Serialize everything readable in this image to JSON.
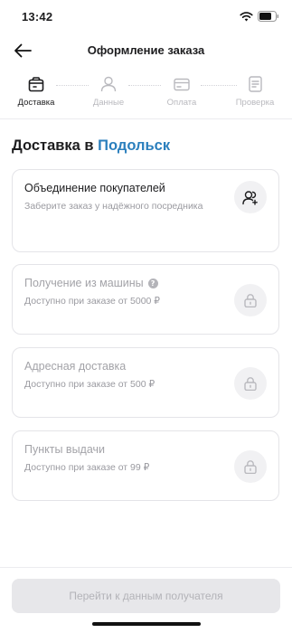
{
  "status_bar": {
    "time": "13:42"
  },
  "header": {
    "title": "Оформление заказа"
  },
  "steps": [
    {
      "label": "Доставка",
      "state": "active",
      "icon": "box-icon"
    },
    {
      "label": "Данные",
      "state": "inactive",
      "icon": "user-icon"
    },
    {
      "label": "Оплата",
      "state": "inactive",
      "icon": "card-icon"
    },
    {
      "label": "Проверка",
      "state": "inactive",
      "icon": "document-icon"
    }
  ],
  "section": {
    "title_prefix": "Доставка в",
    "city": "Подольск"
  },
  "options": [
    {
      "title": "Объединение покупателей",
      "subtitle": "Заберите заказ у надёжного посредника",
      "enabled": true,
      "icon": "users-icon"
    },
    {
      "title": "Получение из машины",
      "subtitle": "Доступно при заказе от 5000 ₽",
      "enabled": false,
      "icon": "lock-icon",
      "help": "?"
    },
    {
      "title": "Адресная доставка",
      "subtitle": "Доступно при заказе от 500 ₽",
      "enabled": false,
      "icon": "lock-icon"
    },
    {
      "title": "Пункты выдачи",
      "subtitle": "Доступно при заказе от 99 ₽",
      "enabled": false,
      "icon": "lock-icon"
    }
  ],
  "footer": {
    "button_label": "Перейти к данным получателя",
    "button_enabled": false
  },
  "colors": {
    "accent": "#2b7fbd",
    "disabled_button": "#e7e7ea"
  }
}
